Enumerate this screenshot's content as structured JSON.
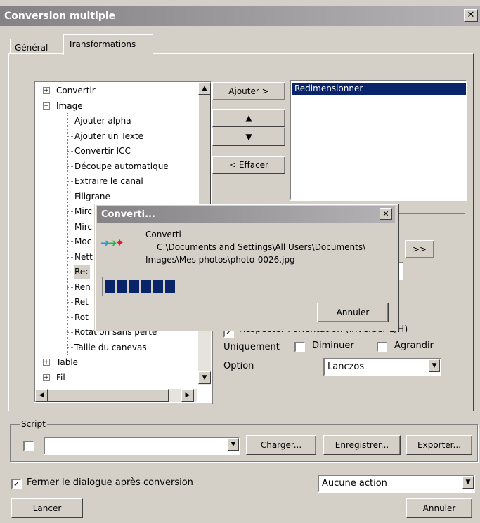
{
  "window": {
    "title": "Conversion multiple"
  },
  "tabs": [
    {
      "label": "Général"
    },
    {
      "label": "Transformations"
    }
  ],
  "tree": {
    "items": [
      {
        "label": "Convertir"
      },
      {
        "label": "Image"
      },
      {
        "label": "Ajouter alpha"
      },
      {
        "label": "Ajouter un Texte"
      },
      {
        "label": "Convertir ICC"
      },
      {
        "label": "Découpe automatique"
      },
      {
        "label": "Extraire le canal"
      },
      {
        "label": "Filigrane"
      },
      {
        "label": "Mirc"
      },
      {
        "label": "Mirc"
      },
      {
        "label": "Moc"
      },
      {
        "label": "Nett"
      },
      {
        "label": "Rec"
      },
      {
        "label": "Ren"
      },
      {
        "label": "Ret"
      },
      {
        "label": "Rot"
      },
      {
        "label": "Rotation sans perte"
      },
      {
        "label": "Taille du canevas"
      },
      {
        "label": "Table"
      },
      {
        "label": "Fil"
      }
    ],
    "selected_index": 12
  },
  "buttons": {
    "add": "Ajouter >",
    "up": "▲",
    "down": "▼",
    "remove": "< Effacer",
    "more": ">>",
    "load": "Charger...",
    "save": "Enregistrer...",
    "export": "Exporter...",
    "run": "Lancer",
    "cancel": "Annuler"
  },
  "selected_list": {
    "items": [
      "Redimensionner"
    ]
  },
  "options": {
    "respect_orientation": "Respecter l'orientation (inverser L/H)",
    "only_label": "Uniquement",
    "decrease": "Diminuer",
    "enlarge": "Agrandir",
    "option_label": "Option",
    "option_value": "Lanczos"
  },
  "script": {
    "label": "Script",
    "value": ""
  },
  "footer": {
    "close_after": "Fermer le dialogue après conversion",
    "close_after_checked": true,
    "action_value": "Aucune action"
  },
  "progress": {
    "title": "Converti...",
    "status": "Converti",
    "path_line1": "C:\\Documents and Settings\\All Users\\Documents\\",
    "path_line2": "Images\\Mes photos\\photo-0026.jpg",
    "blocks_filled": 6,
    "cancel": "Annuler"
  },
  "icons": {
    "close": "close-icon",
    "arrow": "convert-arrows-icon"
  }
}
